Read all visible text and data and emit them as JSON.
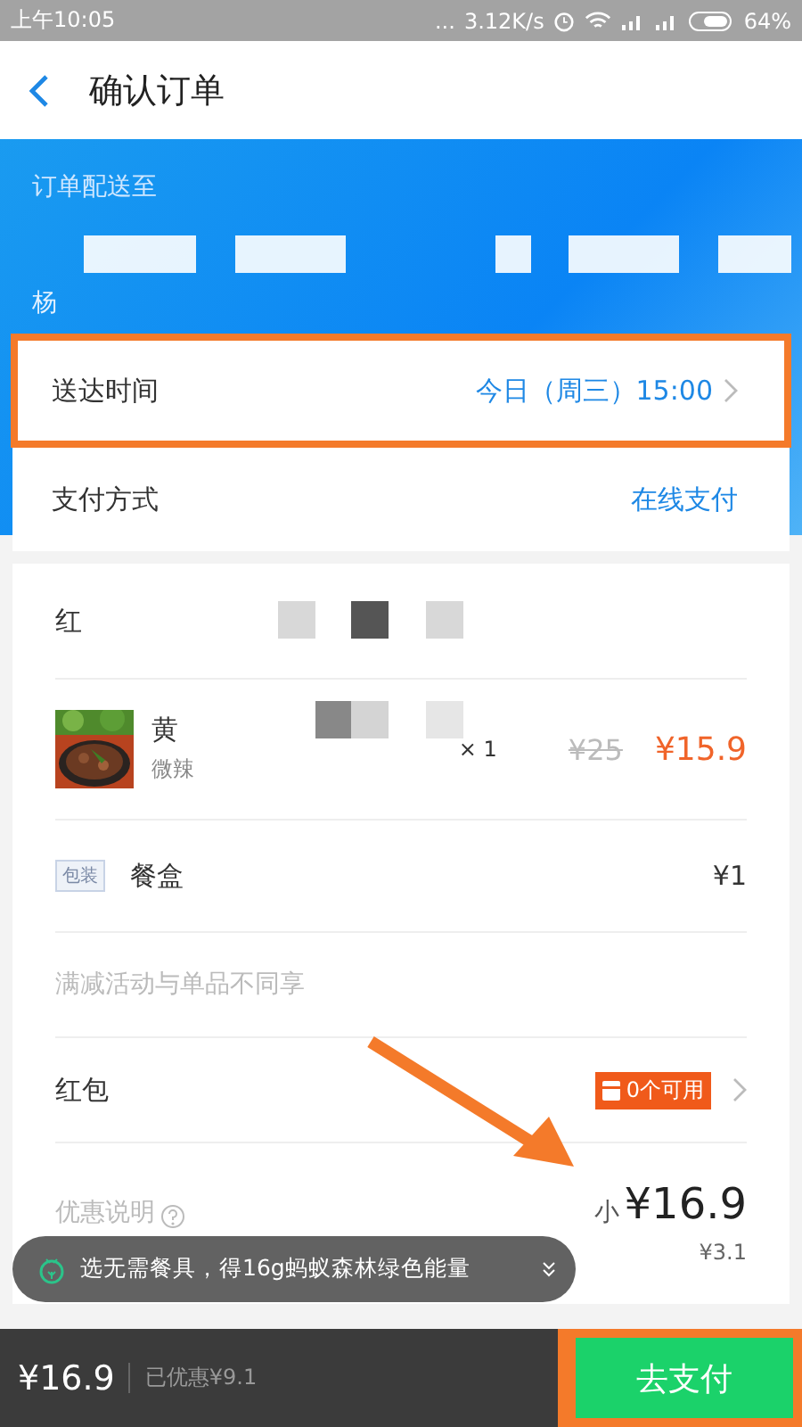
{
  "status_bar": {
    "time": "上午10:05",
    "dots": "...",
    "speed": "3.12K/s",
    "battery": "64%"
  },
  "header": {
    "title": "确认订单"
  },
  "address": {
    "label": "订单配送至",
    "name": "杨"
  },
  "delivery": [
    {
      "kind": "time",
      "label": "送达时间",
      "value": "今日（周三）15:00",
      "highlighted": true
    },
    {
      "kind": "pay",
      "label": "支付方式",
      "value": "在线支付",
      "highlighted": false
    }
  ],
  "shop": {
    "name": "红"
  },
  "items": [
    {
      "name": "黄",
      "spec": "微辣",
      "qty": "× 1",
      "old_price": "¥25",
      "price": "¥15.9"
    }
  ],
  "packing": {
    "tag": "包装",
    "label": "餐盒",
    "price": "¥1"
  },
  "notice": "满减活动与单品不同享",
  "red_packet": {
    "label": "红包",
    "badge": "0个可用"
  },
  "summary": {
    "label": "优惠说明",
    "subtotal_prefix": "小",
    "subtotal": "¥16.9",
    "saved": "¥3.1"
  },
  "toast": "选无需餐具，得16g蚂蚁森林绿色能量",
  "footer": {
    "total": "¥16.9",
    "discount": "已优惠¥9.1",
    "pay": "去支付",
    "highlighted": true
  }
}
